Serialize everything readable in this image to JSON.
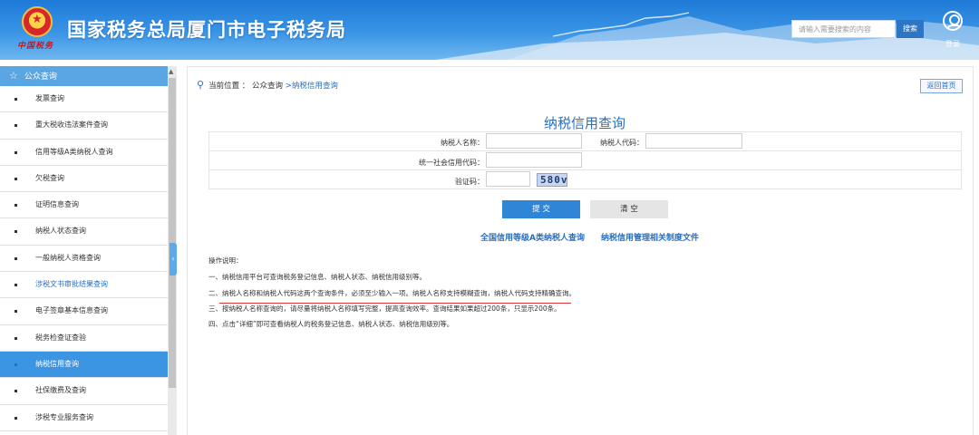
{
  "header": {
    "site_title": "国家税务总局厦门市电子税务局",
    "emblem_text": "中国税务",
    "search_placeholder": "请输入需要搜索的内容",
    "search_button": "搜索",
    "login_label": "登录",
    "bg_color": "#2a84dc"
  },
  "sidebar": {
    "header_label": "公众查询",
    "items": [
      {
        "label": "发票查询",
        "state": "normal"
      },
      {
        "label": "重大税收违法案件查询",
        "state": "normal"
      },
      {
        "label": "信用等级A类纳税人查询",
        "state": "normal"
      },
      {
        "label": "欠税查询",
        "state": "normal"
      },
      {
        "label": "证明信息查询",
        "state": "normal"
      },
      {
        "label": "纳税人状态查询",
        "state": "normal"
      },
      {
        "label": "一般纳税人资格查询",
        "state": "normal"
      },
      {
        "label": "涉税文书审批结果查询",
        "state": "visited"
      },
      {
        "label": "电子签章基本信息查询",
        "state": "normal"
      },
      {
        "label": "税务检查证查验",
        "state": "normal"
      },
      {
        "label": "纳税信用查询",
        "state": "active"
      },
      {
        "label": "社保缴费及查询",
        "state": "normal"
      },
      {
        "label": "涉税专业服务查询",
        "state": "normal"
      }
    ]
  },
  "breadcrumb": {
    "prefix": "当前位置 ：",
    "parent": "公众查询",
    "separator": ">",
    "current": "纳税信用查询"
  },
  "home_button": "返回首页",
  "page_title": "纳税信用查询",
  "form": {
    "taxpayer_name_label": "纳税人名称：",
    "taxpayer_id_label": "纳税人代码：",
    "credit_code_label": "统一社会信用代码：",
    "captcha_label": "验证码：",
    "captcha_value": "580v"
  },
  "buttons": {
    "submit": "提 交",
    "clear": "清 空"
  },
  "links": {
    "grade_a": "全国信用等级A类纳税人查询",
    "regulations": "纳税信用管理相关制度文件"
  },
  "notes": {
    "title": "操作说明：",
    "lines": [
      "一、纳税信用平台可查询税务登记信息、纳税人状态、纳税信用级别等。",
      "二、纳税人名称和纳税人代码这两个查询条件，必须至少输入一项。纳税人名称支持模糊查询，纳税人代码支持精确查询。",
      "三、按纳税人名称查询的，请尽量将纳税人名称填写完整，提高查询效率。查询结果如果超过200条，只显示200条。",
      "四、点击“详细”即可查看纳税人的税务登记信息、纳税人状态、纳税信用级别等。"
    ]
  }
}
